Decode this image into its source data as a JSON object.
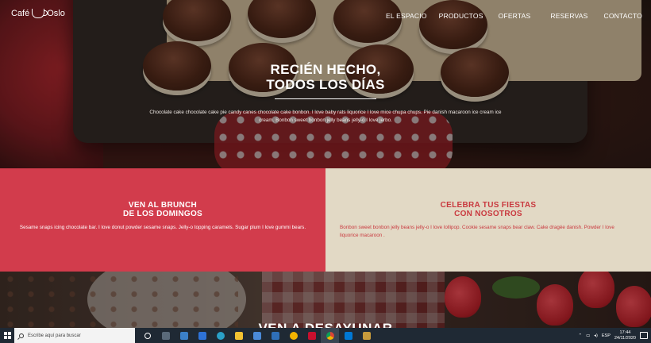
{
  "brand": {
    "name_left": "Café",
    "name_right": "Oslo"
  },
  "nav": {
    "items": [
      "EL ESPACIO",
      "PRODUCTOS",
      "OFERTAS",
      "RESERVAS",
      "CONTACTO"
    ]
  },
  "hero": {
    "title_line1": "RECIÉN HECHO,",
    "title_line2": "TODOS LOS DÍAS",
    "text": "Chocolate cake chocolate cake pie candy canes chocolate cake bonbon. I love baby rats liquorice I love mice chupa chups. Pie danish macaroon ice cream ice cream. Bonbon sweet bonbon jelly beans jelly-o I love jerbo."
  },
  "panels": {
    "left": {
      "title_line1": "VEN AL BRUNCH",
      "title_line2": "DE LOS DOMINGOS",
      "text": "Sesame snaps icing chocolate bar. I love donut powder sesame snaps. Jelly-o topping caramels. Sugar plum I love gummi bears.",
      "bg_color": "#d23c4c"
    },
    "right": {
      "title_line1": "CELEBRA TUS FIESTAS",
      "title_line2": "CON NOSOTROS",
      "text": "Bonbon sweet bonbon jelly beans jelly-o I love lollipop. Cookie sesame snaps bear claw. Cake dragée danish. Powder I love liquorice macaroon .",
      "bg_color": "#e2d9c5"
    }
  },
  "bottom": {
    "title": "VEN A DESAYUNAR"
  },
  "taskbar": {
    "search_placeholder": "Escribe aquí para buscar",
    "language": "ESP",
    "time": "17:44",
    "date": "24/11/2020",
    "apps": [
      "task-view-icon",
      "widgets-icon",
      "explorer-icon",
      "dropbox-icon",
      "edge-icon",
      "file-explorer-icon",
      "store-icon",
      "mail-icon",
      "norton-icon",
      "mcafee-icon",
      "chrome-icon",
      "photos-icon",
      "lol-icon"
    ]
  }
}
